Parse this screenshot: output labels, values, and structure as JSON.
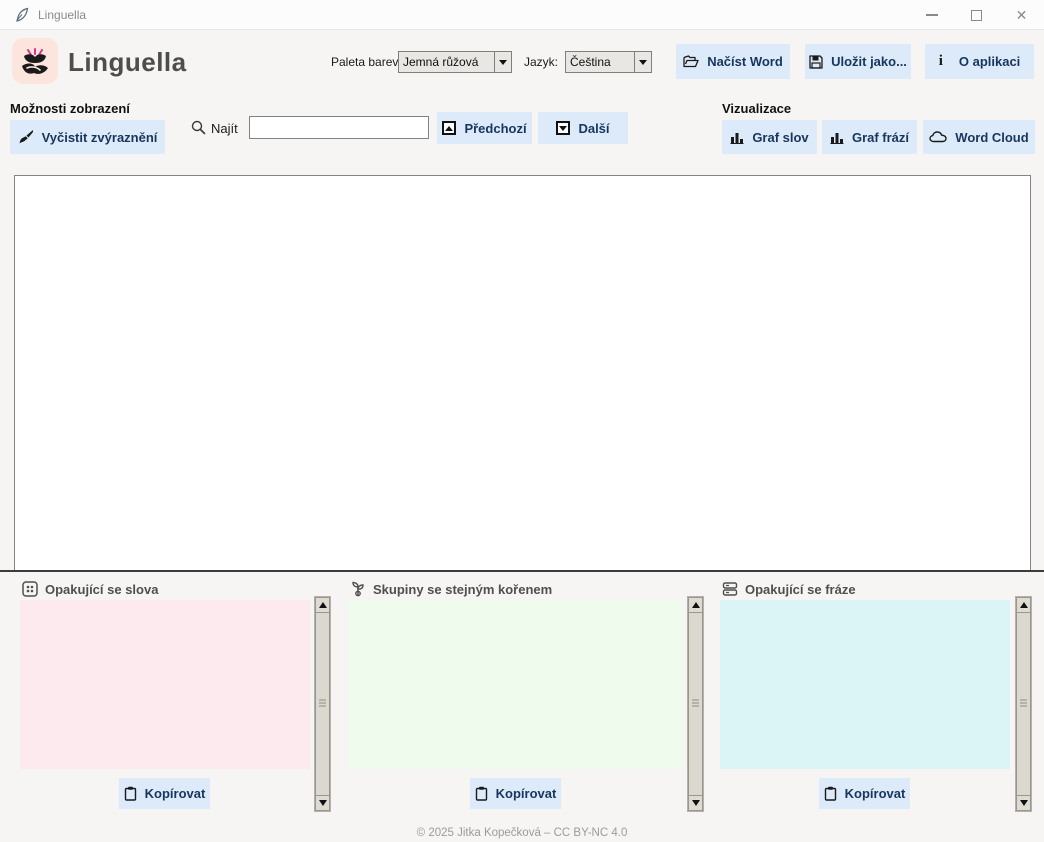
{
  "window": {
    "title": "Linguella",
    "close_glyph": "✕"
  },
  "header": {
    "app_title": "Linguella",
    "palette_label": "Paleta barev",
    "palette_value": "Jemná růžová",
    "language_label": "Jazyk:",
    "language_value": "Čeština",
    "load_word_label": "Načíst Word",
    "save_as_label": "Uložit jako...",
    "about_label": "O aplikaci",
    "about_icon_glyph": "i"
  },
  "toolbar": {
    "display_options_heading": "Možnosti zobrazení",
    "clear_highlight_label": "Vyčistit zvýraznění",
    "find_label": "Najít",
    "find_value": "",
    "previous_label": "Předchozí",
    "next_label": "Další",
    "visualization_heading": "Vizualizace",
    "word_chart_label": "Graf slov",
    "phrase_chart_label": "Graf frází",
    "word_cloud_label": "Word Cloud"
  },
  "editor": {
    "content": ""
  },
  "panels": [
    {
      "title": "Opakující se slova",
      "copy_label": "Kopírovat",
      "bg": "#fdeaee",
      "content": ""
    },
    {
      "title": "Skupiny se stejným kořenem",
      "copy_label": "Kopírovat",
      "bg": "#effbec",
      "content": ""
    },
    {
      "title": "Opakující se fráze",
      "copy_label": "Kopírovat",
      "bg": "#dbf5f7",
      "content": ""
    }
  ],
  "footer": {
    "copyright": "© 2025 Jitka Kopečková – CC BY-NC 4.0"
  },
  "colors": {
    "button_bg": "#dceaf9",
    "button_text": "#17365d",
    "page_bg": "#f6f5f3",
    "titlebar_bg": "#fcfcfc",
    "logo_bg": "#fbe5dd",
    "logo_accent": "#d6368f"
  }
}
